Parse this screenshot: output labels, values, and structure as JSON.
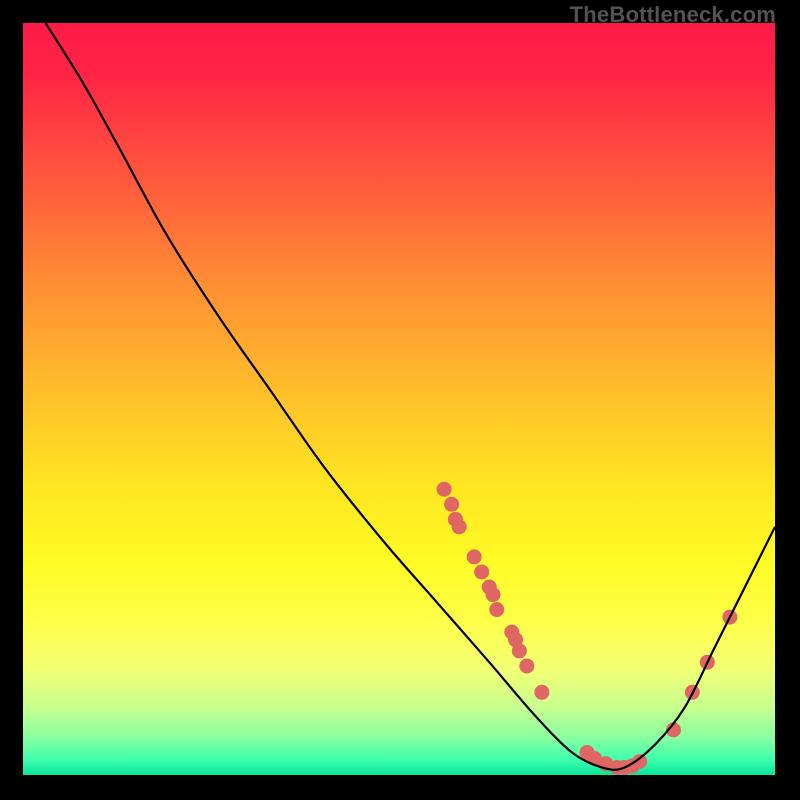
{
  "watermark": "TheBottleneck.com",
  "chart_data": {
    "type": "line",
    "title": "",
    "xlabel": "",
    "ylabel": "",
    "xlim": [
      0,
      100
    ],
    "ylim": [
      0,
      100
    ],
    "curve": [
      {
        "x": 3,
        "y": 100
      },
      {
        "x": 8,
        "y": 92
      },
      {
        "x": 13,
        "y": 83
      },
      {
        "x": 19,
        "y": 72
      },
      {
        "x": 26,
        "y": 61
      },
      {
        "x": 33,
        "y": 51
      },
      {
        "x": 40,
        "y": 41
      },
      {
        "x": 48,
        "y": 31
      },
      {
        "x": 55,
        "y": 23
      },
      {
        "x": 62,
        "y": 15
      },
      {
        "x": 68,
        "y": 8
      },
      {
        "x": 73,
        "y": 3
      },
      {
        "x": 77,
        "y": 1
      },
      {
        "x": 80,
        "y": 1
      },
      {
        "x": 84,
        "y": 4
      },
      {
        "x": 88,
        "y": 9
      },
      {
        "x": 92,
        "y": 17
      },
      {
        "x": 96,
        "y": 25
      },
      {
        "x": 100,
        "y": 33
      }
    ],
    "scatter": [
      {
        "x": 56,
        "y": 38
      },
      {
        "x": 57,
        "y": 36
      },
      {
        "x": 57.5,
        "y": 34
      },
      {
        "x": 58,
        "y": 33
      },
      {
        "x": 60,
        "y": 29
      },
      {
        "x": 61,
        "y": 27
      },
      {
        "x": 62,
        "y": 25
      },
      {
        "x": 62.5,
        "y": 24
      },
      {
        "x": 63,
        "y": 22
      },
      {
        "x": 65,
        "y": 19
      },
      {
        "x": 65.5,
        "y": 18
      },
      {
        "x": 66,
        "y": 16.5
      },
      {
        "x": 67,
        "y": 14.5
      },
      {
        "x": 69,
        "y": 11
      },
      {
        "x": 75,
        "y": 3
      },
      {
        "x": 76,
        "y": 2.2
      },
      {
        "x": 77.5,
        "y": 1.5
      },
      {
        "x": 79,
        "y": 1
      },
      {
        "x": 80,
        "y": 1
      },
      {
        "x": 81,
        "y": 1.2
      },
      {
        "x": 82,
        "y": 1.8
      },
      {
        "x": 86.5,
        "y": 6
      },
      {
        "x": 89,
        "y": 11
      },
      {
        "x": 91,
        "y": 15
      },
      {
        "x": 94,
        "y": 21
      }
    ],
    "colors": {
      "curve": "#000000",
      "scatter": "#e06663"
    }
  }
}
